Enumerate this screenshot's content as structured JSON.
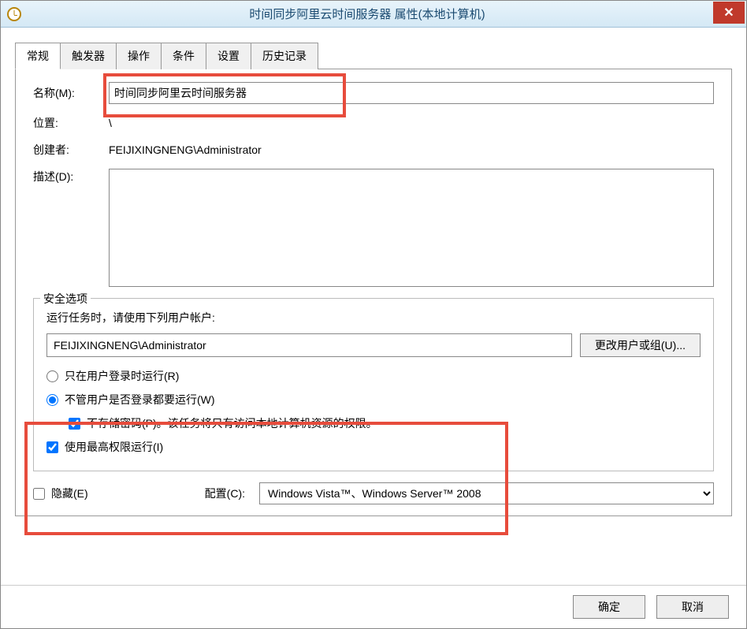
{
  "window": {
    "title": "时间同步阿里云时间服务器 属性(本地计算机)"
  },
  "tabs": {
    "general": "常规",
    "triggers": "触发器",
    "actions": "操作",
    "conditions": "条件",
    "settings": "设置",
    "history": "历史记录"
  },
  "fields": {
    "name_label": "名称(M):",
    "name_value": "时间同步阿里云时间服务器",
    "location_label": "位置:",
    "location_value": "\\",
    "author_label": "创建者:",
    "author_value": "FEIJIXINGNENG\\Administrator",
    "description_label": "描述(D):",
    "description_value": ""
  },
  "security": {
    "legend": "安全选项",
    "run_as_label": "运行任务时，请使用下列用户帐户:",
    "account_value": "FEIJIXINGNENG\\Administrator",
    "change_user_btn": "更改用户或组(U)...",
    "run_only_logged": "只在用户登录时运行(R)",
    "run_whether_logged": "不管用户是否登录都要运行(W)",
    "no_store_password": "不存储密码(P)。该任务将只有访问本地计算机资源的权限。",
    "highest_priv": "使用最高权限运行(I)"
  },
  "bottom": {
    "hidden_label": "隐藏(E)",
    "config_label": "配置(C):",
    "config_value": "Windows Vista™、Windows Server™ 2008"
  },
  "buttons": {
    "ok": "确定",
    "cancel": "取消"
  }
}
